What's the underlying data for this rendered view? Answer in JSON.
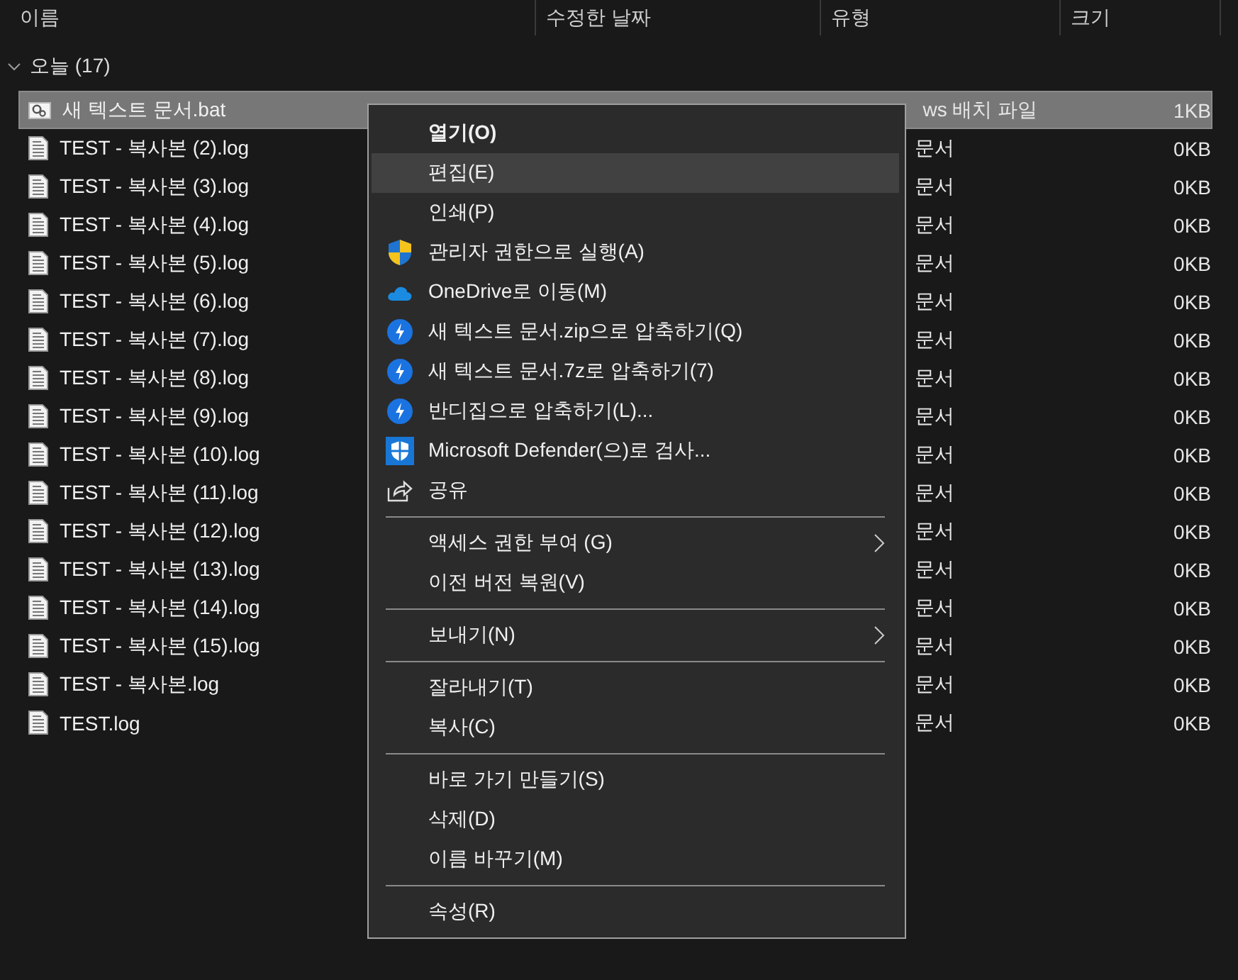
{
  "columns": [
    {
      "label": "이름"
    },
    {
      "label": "수정한 날짜"
    },
    {
      "label": "유형"
    },
    {
      "label": "크기"
    }
  ],
  "group": {
    "label": "오늘 (17)",
    "expanded": true
  },
  "files": [
    {
      "name": "새 텍스트 문서.bat",
      "kind": "bat",
      "selected": true,
      "type": "ws 배치 파일",
      "size": "1KB"
    },
    {
      "name": "TEST - 복사본 (2).log",
      "kind": "log",
      "selected": false,
      "type": "문서",
      "size": "0KB"
    },
    {
      "name": "TEST - 복사본 (3).log",
      "kind": "log",
      "selected": false,
      "type": "문서",
      "size": "0KB"
    },
    {
      "name": "TEST - 복사본 (4).log",
      "kind": "log",
      "selected": false,
      "type": "문서",
      "size": "0KB"
    },
    {
      "name": "TEST - 복사본 (5).log",
      "kind": "log",
      "selected": false,
      "type": "문서",
      "size": "0KB"
    },
    {
      "name": "TEST - 복사본 (6).log",
      "kind": "log",
      "selected": false,
      "type": "문서",
      "size": "0KB"
    },
    {
      "name": "TEST - 복사본 (7).log",
      "kind": "log",
      "selected": false,
      "type": "문서",
      "size": "0KB"
    },
    {
      "name": "TEST - 복사본 (8).log",
      "kind": "log",
      "selected": false,
      "type": "문서",
      "size": "0KB"
    },
    {
      "name": "TEST - 복사본 (9).log",
      "kind": "log",
      "selected": false,
      "type": "문서",
      "size": "0KB"
    },
    {
      "name": "TEST - 복사본 (10).log",
      "kind": "log",
      "selected": false,
      "type": "문서",
      "size": "0KB"
    },
    {
      "name": "TEST - 복사본 (11).log",
      "kind": "log",
      "selected": false,
      "type": "문서",
      "size": "0KB"
    },
    {
      "name": "TEST - 복사본 (12).log",
      "kind": "log",
      "selected": false,
      "type": "문서",
      "size": "0KB"
    },
    {
      "name": "TEST - 복사본 (13).log",
      "kind": "log",
      "selected": false,
      "type": "문서",
      "size": "0KB"
    },
    {
      "name": "TEST - 복사본 (14).log",
      "kind": "log",
      "selected": false,
      "type": "문서",
      "size": "0KB"
    },
    {
      "name": "TEST - 복사본 (15).log",
      "kind": "log",
      "selected": false,
      "type": "문서",
      "size": "0KB"
    },
    {
      "name": "TEST - 복사본.log",
      "kind": "log",
      "selected": false,
      "type": "문서",
      "size": "0KB"
    },
    {
      "name": "TEST.log",
      "kind": "log",
      "selected": false,
      "type": "문서",
      "size": "0KB"
    }
  ],
  "context_menu": [
    {
      "kind": "plain",
      "label": "열기(O)",
      "default": true,
      "hovered": false,
      "submenu": false
    },
    {
      "kind": "plain",
      "label": "편집(E)",
      "default": false,
      "hovered": true,
      "submenu": false
    },
    {
      "kind": "plain",
      "label": "인쇄(P)",
      "default": false,
      "hovered": false,
      "submenu": false
    },
    {
      "kind": "uac",
      "label": "관리자 권한으로 실행(A)",
      "default": false,
      "hovered": false,
      "submenu": false
    },
    {
      "kind": "cloud",
      "label": "OneDrive로 이동(M)",
      "default": false,
      "hovered": false,
      "submenu": false
    },
    {
      "kind": "bolt",
      "label": "새 텍스트 문서.zip으로 압축하기(Q)",
      "default": false,
      "hovered": false,
      "submenu": false
    },
    {
      "kind": "bolt",
      "label": "새 텍스트 문서.7z로 압축하기(7)",
      "default": false,
      "hovered": false,
      "submenu": false
    },
    {
      "kind": "bolt",
      "label": "반디집으로 압축하기(L)...",
      "default": false,
      "hovered": false,
      "submenu": false
    },
    {
      "kind": "defender",
      "label": "Microsoft Defender(으)로 검사...",
      "default": false,
      "hovered": false,
      "submenu": false
    },
    {
      "kind": "share",
      "label": "공유",
      "default": false,
      "hovered": false,
      "submenu": false
    },
    {
      "kind": "separator"
    },
    {
      "kind": "plain",
      "label": "액세스 권한 부여 (G)",
      "default": false,
      "hovered": false,
      "submenu": true
    },
    {
      "kind": "plain",
      "label": "이전 버전 복원(V)",
      "default": false,
      "hovered": false,
      "submenu": false
    },
    {
      "kind": "separator"
    },
    {
      "kind": "plain",
      "label": "보내기(N)",
      "default": false,
      "hovered": false,
      "submenu": true
    },
    {
      "kind": "separator"
    },
    {
      "kind": "plain",
      "label": "잘라내기(T)",
      "default": false,
      "hovered": false,
      "submenu": false
    },
    {
      "kind": "plain",
      "label": "복사(C)",
      "default": false,
      "hovered": false,
      "submenu": false
    },
    {
      "kind": "separator"
    },
    {
      "kind": "plain",
      "label": "바로 가기 만들기(S)",
      "default": false,
      "hovered": false,
      "submenu": false
    },
    {
      "kind": "plain",
      "label": "삭제(D)",
      "default": false,
      "hovered": false,
      "submenu": false
    },
    {
      "kind": "plain",
      "label": "이름 바꾸기(M)",
      "default": false,
      "hovered": false,
      "submenu": false
    },
    {
      "kind": "separator"
    },
    {
      "kind": "plain",
      "label": "속성(R)",
      "default": false,
      "hovered": false,
      "submenu": false
    }
  ]
}
